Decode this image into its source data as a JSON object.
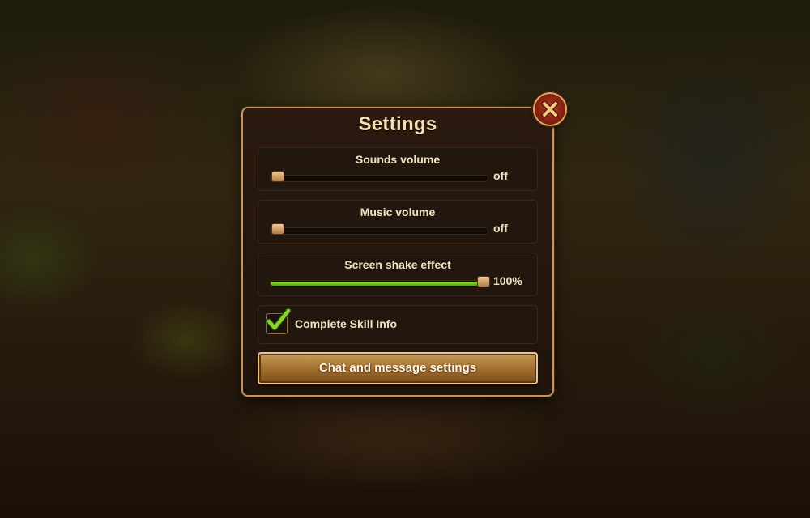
{
  "dialog": {
    "title": "Settings"
  },
  "settings": {
    "sounds_volume": {
      "label": "Sounds volume",
      "value_text": "off",
      "level": 0.0
    },
    "music_volume": {
      "label": "Music volume",
      "value_text": "off",
      "level": 0.0
    },
    "screen_shake": {
      "label": "Screen shake effect",
      "value_text": "100%",
      "level": 1.0
    },
    "complete_skill_info": {
      "label": "Complete Skill Info",
      "checked": true
    }
  },
  "chat_button": {
    "label": "Chat and message settings"
  },
  "icons": {
    "close": "close-icon",
    "check": "checkmark-icon"
  },
  "colors": {
    "accent_green": "#9ce53c",
    "panel_border": "#c7935a",
    "close_red": "#b83b1f"
  }
}
